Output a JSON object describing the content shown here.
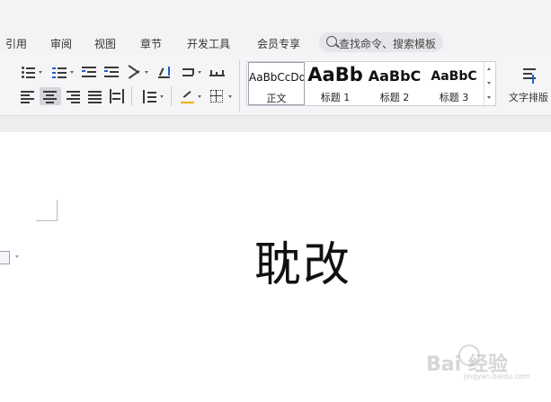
{
  "menubar": {
    "items": [
      "引用",
      "审阅",
      "视图",
      "章节",
      "开发工具",
      "会员专享"
    ],
    "search_placeholder": "查找命令、搜索模板"
  },
  "ribbon": {
    "styles": [
      {
        "sample": "AaBbCcDd",
        "label": "正文",
        "selected": true
      },
      {
        "sample": "AaBb",
        "label": "标题 1"
      },
      {
        "sample": "AaBbC",
        "label": "标题 2"
      },
      {
        "sample": "AaBbC",
        "label": "标题 3"
      }
    ],
    "text_layout_label": "文字排版"
  },
  "document": {
    "text": "耽改"
  },
  "watermark": {
    "text": "Bai 经验",
    "subtext": "jingyan.baidu.com"
  },
  "colors": {
    "chrome_bg": "#f3f3f5",
    "ribbon_bg": "#f5f5f7",
    "page_bg": "#ffffff"
  }
}
